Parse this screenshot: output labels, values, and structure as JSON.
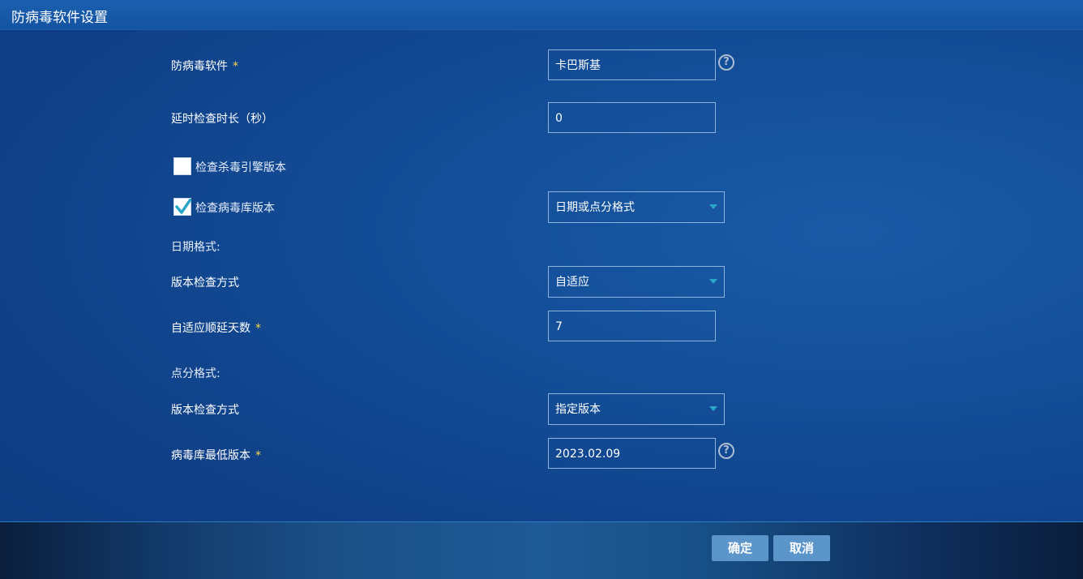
{
  "window": {
    "title": "防病毒软件设置"
  },
  "form": {
    "antivirus": {
      "label": "防病毒软件",
      "required_mark": "*",
      "value": "卡巴斯基",
      "help": "?"
    },
    "delay": {
      "label": "延时检查时长（秒）",
      "value": "0"
    },
    "check_engine": {
      "label": "检查杀毒引擎版本",
      "checked": false
    },
    "check_virus_db": {
      "label": "检查病毒库版本",
      "checked": true,
      "format_value": "日期或点分格式"
    },
    "date_section": {
      "label": "日期格式:"
    },
    "date_check_mode": {
      "label": "版本检查方式",
      "value": "自适应"
    },
    "adaptive_days": {
      "label": "自适应顺延天数",
      "required_mark": "*",
      "value": "7"
    },
    "dot_section": {
      "label": "点分格式:"
    },
    "dot_check_mode": {
      "label": "版本检查方式",
      "value": "指定版本"
    },
    "min_db_version": {
      "label": "病毒库最低版本",
      "required_mark": "*",
      "value": "2023.02.09",
      "help": "?"
    }
  },
  "footer": {
    "ok_label": "确定",
    "cancel_label": "取消"
  },
  "colors": {
    "accent_arrow": "#2aa6c8",
    "required": "#ffd84a",
    "button_bg": "#5b95c9"
  }
}
